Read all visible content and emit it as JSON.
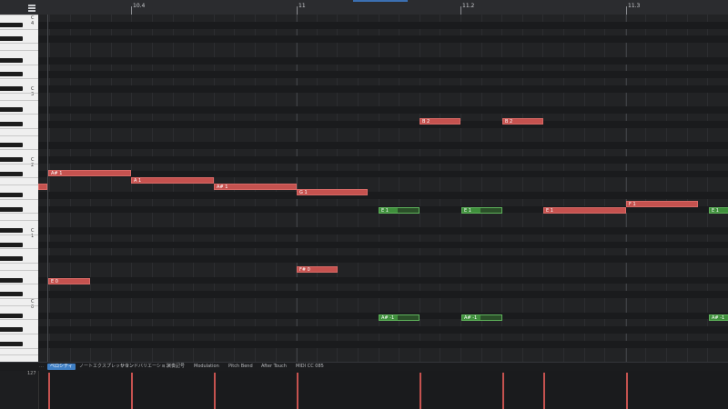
{
  "ruler": {
    "labels": [
      "10.4",
      "11",
      "11.2",
      "11.3"
    ]
  },
  "keyboard": {
    "c_labels": [
      "C 4",
      "C 3",
      "C 2",
      "C 1",
      "C 0"
    ]
  },
  "notes": [
    {
      "label": "",
      "color": "red"
    },
    {
      "label": "A# 1",
      "color": "red"
    },
    {
      "label": "A 1",
      "color": "red"
    },
    {
      "label": "A# 1",
      "color": "red"
    },
    {
      "label": "G 1",
      "color": "red"
    },
    {
      "label": "B 2",
      "color": "red"
    },
    {
      "label": "B 2",
      "color": "red"
    },
    {
      "label": "E 1",
      "color": "green"
    },
    {
      "label": "E 1",
      "color": "green"
    },
    {
      "label": "E 1",
      "color": "red"
    },
    {
      "label": "F 1",
      "color": "red"
    },
    {
      "label": "E 1",
      "color": "green"
    },
    {
      "label": "F# 0",
      "color": "red"
    },
    {
      "label": "E 0",
      "color": "red"
    },
    {
      "label": "A# -1",
      "color": "green"
    },
    {
      "label": "A# -1",
      "color": "green"
    },
    {
      "label": "A# -1",
      "color": "green"
    }
  ],
  "lane_tabs": [
    "ベロシティ",
    "ノートエクスプレッション",
    "サウンドバリエーション",
    "演奏記号",
    "Modulation",
    "Pitch Bend",
    "After Touch",
    "MIDI CC 085"
  ],
  "velocity": {
    "max_label": "127"
  },
  "colors": {
    "note": "#c5524f",
    "selected_note": "#3f8f3c",
    "active_tab": "#3f7fc4"
  }
}
